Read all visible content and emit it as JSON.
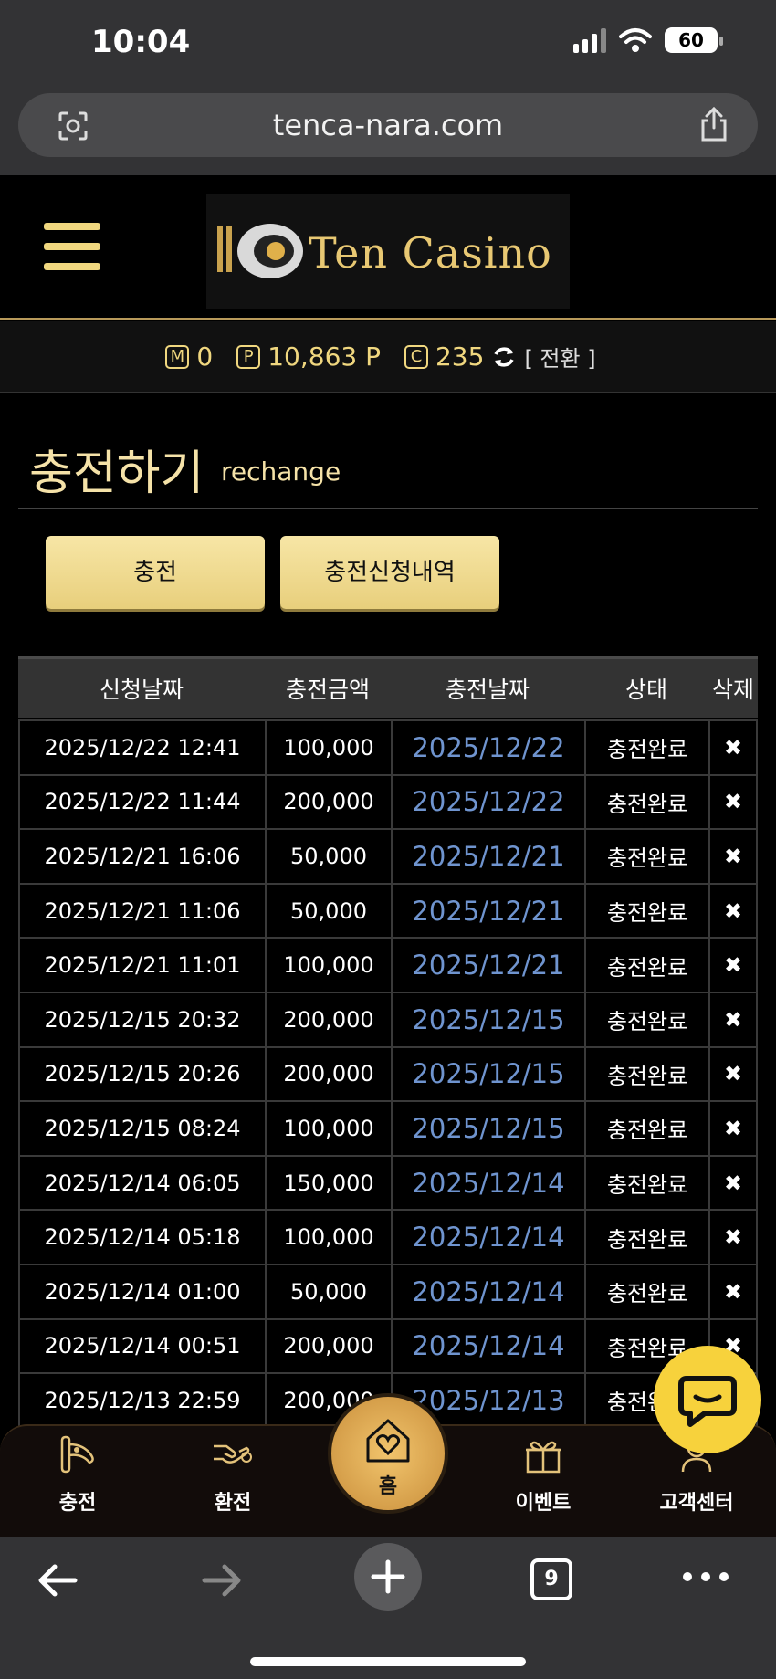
{
  "status_bar": {
    "time": "10:04",
    "battery": "60"
  },
  "browser": {
    "url": "tenca-nara.com",
    "tab_count": "9"
  },
  "site": {
    "logo_text": "Ten Casino",
    "points": {
      "m_label": "M",
      "m_value": "0",
      "p_label": "P",
      "p_value": "10,863 P",
      "c_label": "C",
      "c_value": "235",
      "switch_label": "[ 전환 ]"
    }
  },
  "page": {
    "title": "충전하기",
    "subtitle": "rechange"
  },
  "buttons": {
    "charge": "충전",
    "history": "충전신청내역"
  },
  "table": {
    "headers": [
      "신청날짜",
      "충전금액",
      "충전날짜",
      "상태",
      "삭제"
    ],
    "rows": [
      [
        "2025/12/22 12:41",
        "100,000",
        "2025/12/22",
        "충전완료",
        "✖"
      ],
      [
        "2025/12/22 11:44",
        "200,000",
        "2025/12/22",
        "충전완료",
        "✖"
      ],
      [
        "2025/12/21 16:06",
        "50,000",
        "2025/12/21",
        "충전완료",
        "✖"
      ],
      [
        "2025/12/21 11:06",
        "50,000",
        "2025/12/21",
        "충전완료",
        "✖"
      ],
      [
        "2025/12/21 11:01",
        "100,000",
        "2025/12/21",
        "충전완료",
        "✖"
      ],
      [
        "2025/12/15 20:32",
        "200,000",
        "2025/12/15",
        "충전완료",
        "✖"
      ],
      [
        "2025/12/15 20:26",
        "200,000",
        "2025/12/15",
        "충전완료",
        "✖"
      ],
      [
        "2025/12/15 08:24",
        "100,000",
        "2025/12/15",
        "충전완료",
        "✖"
      ],
      [
        "2025/12/14 06:05",
        "150,000",
        "2025/12/14",
        "충전완료",
        "✖"
      ],
      [
        "2025/12/14 05:18",
        "100,000",
        "2025/12/14",
        "충전완료",
        "✖"
      ],
      [
        "2025/12/14 01:00",
        "50,000",
        "2025/12/14",
        "충전완료",
        "✖"
      ],
      [
        "2025/12/14 00:51",
        "200,000",
        "2025/12/14",
        "충전완료",
        "✖"
      ],
      [
        "2025/12/13 22:59",
        "200,000",
        "2025/12/13",
        "충전완료",
        "✖"
      ]
    ]
  },
  "bottom_nav": {
    "charge": "충전",
    "exchange": "환전",
    "home": "홈",
    "event": "이벤트",
    "support": "고객센터"
  },
  "icons": {
    "hamburger": "menu-icon",
    "refresh": "refresh-icon",
    "chat": "chat-icon",
    "home": "house-heart-icon"
  },
  "colors": {
    "accent": "#f0d77f",
    "link": "#6f94cf",
    "button": "#f5e2a0",
    "chat": "#f7d23c"
  }
}
